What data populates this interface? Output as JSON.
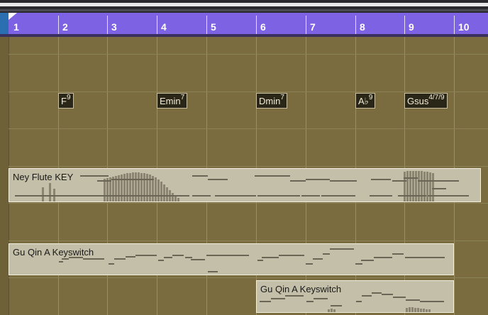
{
  "ruler": {
    "bars": [
      "1",
      "2",
      "3",
      "4",
      "5",
      "6",
      "7",
      "8",
      "9",
      "10"
    ]
  },
  "chords": [
    {
      "root": "F",
      "ext": "9"
    },
    {
      "root": "Emin",
      "ext": "7"
    },
    {
      "root": "Dmin",
      "ext": "7"
    },
    {
      "root": "A♭",
      "ext": "9"
    },
    {
      "root": "Gsus",
      "ext": "4/7/9"
    }
  ],
  "regions": [
    {
      "name": "Ney Flute KEY"
    },
    {
      "name": "Gu Qin A Keyswitch"
    },
    {
      "name": "Gu Qin A Keyswitch"
    }
  ],
  "colors": {
    "lane_bg": "#7a6c3f",
    "ruler": "#7d62e4",
    "region_fill": "#c4bfa8",
    "note": "#6b6555"
  }
}
